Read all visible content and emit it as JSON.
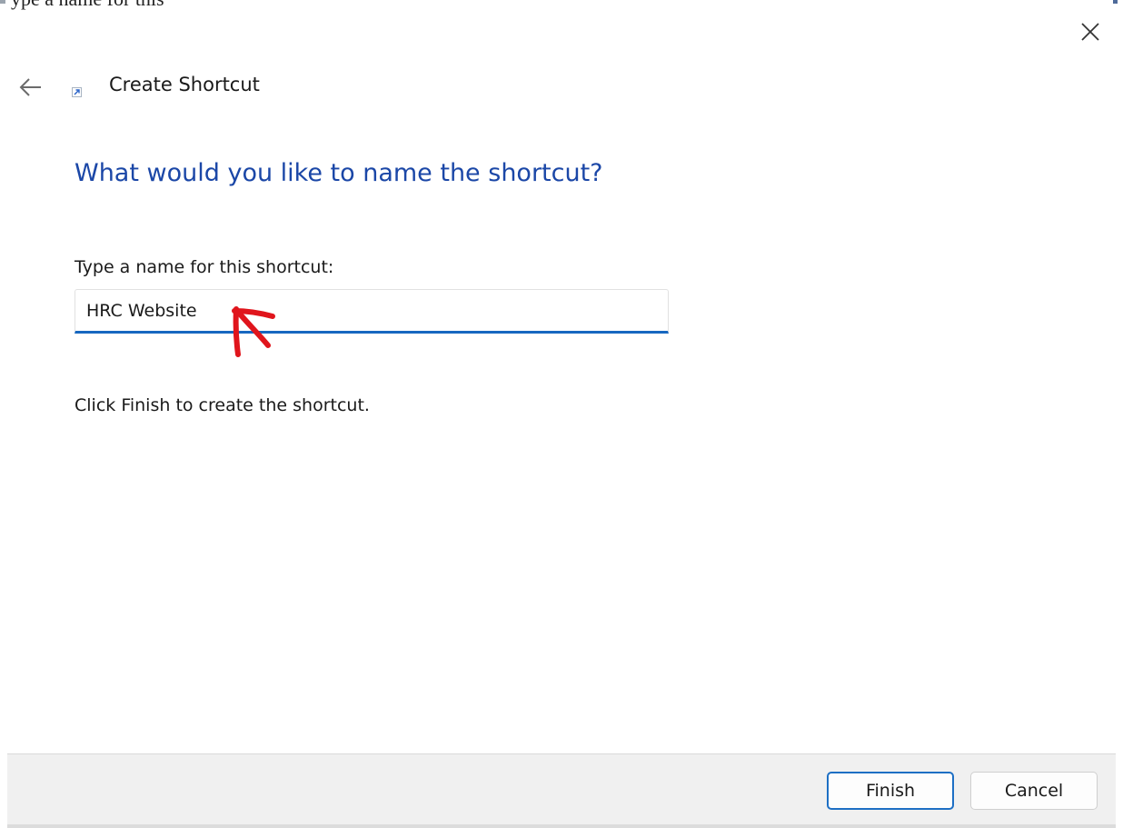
{
  "window": {
    "wizard_title": "Create Shortcut"
  },
  "background_snippet": {
    "text": "ype a name for this"
  },
  "page": {
    "heading": "What would you like to name the shortcut?",
    "name_label": "Type a name for this shortcut:",
    "name_value": "HRC Website",
    "finish_hint": "Click Finish to create the shortcut."
  },
  "footer": {
    "finish_label": "Finish",
    "cancel_label": "Cancel"
  },
  "icons": {
    "close": "close-icon",
    "back": "back-arrow-icon",
    "shortcut": "shortcut-icon",
    "annotation": "red-arrow-annotation-icon"
  },
  "colors": {
    "accent": "#1767c0",
    "heading": "#1b47a7",
    "annotation": "#e0151c",
    "footer_bg": "#f0f0f0"
  }
}
